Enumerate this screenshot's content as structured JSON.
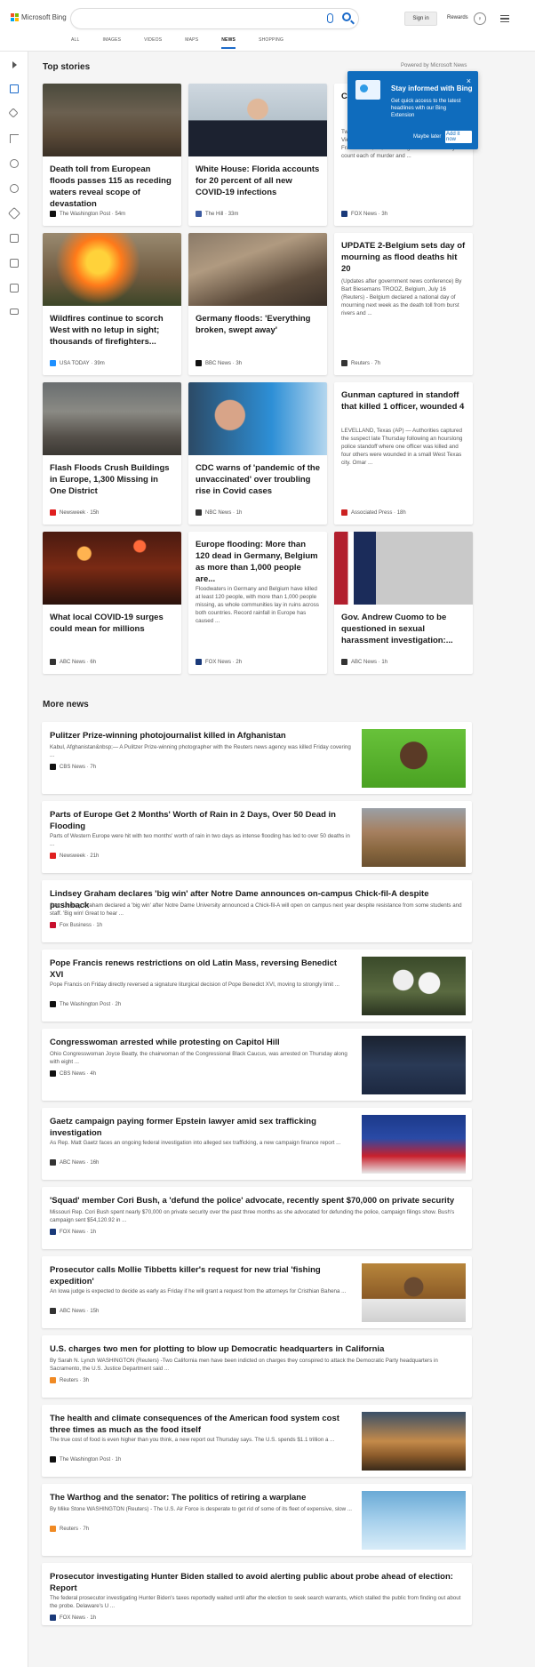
{
  "header": {
    "brand": "Microsoft Bing",
    "signin": "Sign in",
    "rewards": "Rewards",
    "tabs": [
      "ALL",
      "IMAGES",
      "VIDEOS",
      "MAPS",
      "NEWS",
      "SHOPPING"
    ],
    "active_tab": "NEWS"
  },
  "sections": {
    "top_stories": "Top stories",
    "powered_by": "Powered by Microsoft News",
    "more_news": "More news"
  },
  "popup": {
    "title": "Stay informed with Bing",
    "text": "Get quick access to the latest headlines with our Bing Extension",
    "later": "Maybe later",
    "add": "Add it now",
    "close": "×"
  },
  "top_stories": [
    {
      "title": "Death toll from European floods passes 115 as receding waters reveal scope of devastation",
      "source": "The Washington Post",
      "time": "54m",
      "fav": "#111111",
      "img": "flood"
    },
    {
      "title": "White House: Florida accounts for 20 percent of all new COVID-19 infections",
      "source": "The Hill",
      "time": "33m",
      "fav": "#3b5aa0",
      "img": "desantis"
    },
    {
      "title": "Ch... ch... th...",
      "snippet": "Tw... brutal attempted carjacking that left a Vietnam War veteran dead of a heart attack. Frank Harris, 18, was charged with one felony count each of murder and ...",
      "source": "FOX News",
      "time": "3h",
      "fav": "#1a3a7a"
    },
    {
      "title": "Wildfires continue to scorch West with no letup in sight; thousands of firefighters...",
      "source": "USA TODAY",
      "time": "39m",
      "fav": "#1e90ff",
      "img": "fire"
    },
    {
      "title": "Germany floods: 'Everything broken, swept away'",
      "source": "BBC News",
      "time": "3h",
      "fav": "#111111",
      "img": "debris"
    },
    {
      "title": "UPDATE 2-Belgium sets day of mourning as flood deaths hit 20",
      "snippet": "(Updates after government news conference) By Bart Biesemans TROOZ, Belgium, July 16 (Reuters) - Belgium declared a national day of mourning next week as the death toll from burst rivers and ...",
      "source": "Reuters",
      "time": "7h",
      "fav": "#333333"
    },
    {
      "title": "Flash Floods Crush Buildings in Europe, 1,300 Missing in One District",
      "source": "Newsweek",
      "time": "15h",
      "fav": "#e02020",
      "img": "street"
    },
    {
      "title": "CDC warns of 'pandemic of the unvaccinated' over troubling rise in Covid cases",
      "source": "NBC News",
      "time": "1h",
      "fav": "#333333",
      "img": "vaccine"
    },
    {
      "title": "Gunman captured in standoff that killed 1 officer, wounded 4",
      "snippet": "LEVELLAND, Texas (AP) — Authorities captured the suspect late Thursday following an hourslong police standoff where one officer was killed and four others were wounded in a small West Texas city. Omar ...",
      "source": "Associated Press",
      "time": "18h",
      "fav": "#cc2222"
    },
    {
      "title": "What local COVID-19 surges could mean for millions",
      "source": "ABC News",
      "time": "6h",
      "fav": "#333333",
      "img": "bar"
    },
    {
      "title": "Europe flooding: More than 120 dead in Germany, Belgium as more than 1,000 people are...",
      "snippet": "Floodwaters in Germany and Belgium have killed at least 120 people, with more than 1,000 people missing, as whole communities lay in ruins across both countries.  Record rainfall in Europe has caused ...",
      "source": "FOX News",
      "time": "2h",
      "fav": "#1a3a7a"
    },
    {
      "title": "Gov. Andrew Cuomo to be questioned in sexual harassment investigation:...",
      "source": "ABC News",
      "time": "1h",
      "fav": "#333333",
      "img": "cuomo"
    }
  ],
  "more_news": [
    {
      "title": "Pulitzer Prize-winning photojournalist killed in Afghanistan",
      "snippet": "Kabul, Afghanistan&nbsp;— A Pulitzer Prize-winning photographer with the Reuters news agency was killed Friday covering ...",
      "source": "CBS News",
      "time": "7h",
      "fav": "#111111",
      "img": "portrait"
    },
    {
      "title": "Parts of Europe Get 2 Months' Worth of Rain in 2 Days, Over 50 Dead in Flooding",
      "snippet": "Parts of Western Europe were hit with two months' worth of rain in two days as intense flooding has led to over 50 deaths in ...",
      "source": "Newsweek",
      "time": "21h",
      "fav": "#e02020",
      "img": "flood2"
    },
    {
      "title": "Lindsey Graham declares 'big win' after Notre Dame announces on-campus Chick-fil-A despite pushback",
      "snippet": "Sen. Lindsey Graham declared a 'big win' after Notre Dame University announced a Chick-fil-A will open on campus next year despite resistance from some students and staff. 'Big win!  Great to hear ...",
      "source": "Fox Business",
      "time": "1h",
      "fav": "#c8102e"
    },
    {
      "title": "Pope Francis renews restrictions on old Latin Mass, reversing Benedict XVI",
      "snippet": "Pope Francis on Friday directly reversed a signature liturgical decision of Pope Benedict XVI, moving to strongly limit ...",
      "source": "The Washington Post",
      "time": "2h",
      "fav": "#111111",
      "img": "pope"
    },
    {
      "title": "Congresswoman arrested while protesting on Capitol Hill",
      "snippet": "Ohio Congresswoman Joyce Beatty, the chairwoman of the Congressional Black Caucus, was arrested on Thursday along with eight ...",
      "source": "CBS News",
      "time": "4h",
      "fav": "#111111",
      "img": "police"
    },
    {
      "title": "Gaetz campaign paying former Epstein lawyer amid sex trafficking investigation",
      "snippet": "As Rep. Matt Gaetz faces an ongoing federal investigation into alleged sex trafficking, a new campaign finance report ...",
      "source": "ABC News",
      "time": "16h",
      "fav": "#333333",
      "img": "rally"
    },
    {
      "title": "'Squad' member Cori Bush, a 'defund the police' advocate, recently spent $70,000 on private security",
      "snippet": "Missouri Rep. Cori Bush spent nearly $70,000 on private security over the past three months as she advocated for defunding the police, campaign filings show. Bush's campaign sent $54,120.92 in ...",
      "source": "FOX News",
      "time": "1h",
      "fav": "#1a3a7a"
    },
    {
      "title": "Prosecutor calls Mollie Tibbetts killer's request for new trial 'fishing expedition'",
      "snippet": "An Iowa judge is expected to decide as early as Friday if he will grant a request from the attorneys for Cristhian Bahena ...",
      "source": "ABC News",
      "time": "15h",
      "fav": "#333333",
      "img": "court"
    },
    {
      "title": "U.S. charges two men for plotting to blow up Democratic headquarters in California",
      "snippet": "By Sarah N. Lynch WASHINGTON (Reuters) -Two California men have been indicted on charges they conspired to attack the Democratic Party headquarters in Sacramento, the U.S. Justice Department said ...",
      "source": "Reuters",
      "time": "3h",
      "fav": "#f08a24"
    },
    {
      "title": "The health and climate consequences of the American food system cost three times as much as the food itself",
      "snippet": "The true cost of food is even higher than you think, a new report out Thursday says. The U.S. spends $1.1 trillion a ...",
      "source": "The Washington Post",
      "time": "1h",
      "fav": "#111111",
      "img": "farm"
    },
    {
      "title": "The Warthog and the senator: The politics of retiring a warplane",
      "snippet": "By Mike Stone WASHINGTON (Reuters) - The U.S. Air Force is desperate to get rid of some of its fleet of expensive, slow ...",
      "source": "Reuters",
      "time": "7h",
      "fav": "#f08a24",
      "img": "planes"
    },
    {
      "title": "Prosecutor investigating Hunter Biden stalled to avoid alerting public about probe ahead of election: Report",
      "snippet": "The federal prosecutor investigating Hunter Biden's taxes reportedly waited until after the election to seek search warrants, which stalled the public from finding out about the probe.  Delaware's U ...",
      "source": "FOX News",
      "time": "1h",
      "fav": "#1a3a7a"
    }
  ]
}
